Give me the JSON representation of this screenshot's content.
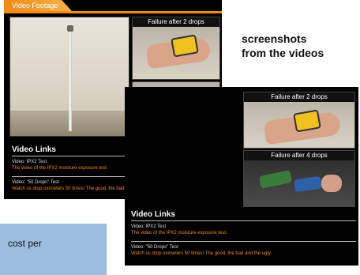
{
  "back_panel": {
    "tab_label": "Video Footage",
    "thumb1_title": "Failure after 2 drops",
    "links": {
      "heading": "Video Links",
      "items": [
        {
          "title": "Video: IPX2 Test",
          "desc": "The video of the IPX2 moisture exposure test."
        },
        {
          "title": "Video: \"50 Drops\" Test",
          "desc": "Watch us drop oximeters 50 times! The good, the bad and the ugly."
        }
      ]
    }
  },
  "caption": {
    "line1": "screenshots",
    "line2": "from the videos"
  },
  "front_panel": {
    "thumb1_title": "Failure after 2 drops",
    "thumb2_title": "Failure after 4 drops",
    "links": {
      "heading": "Video Links",
      "items": [
        {
          "title": "Video: IPX2 Test",
          "desc": "The video of the IPX2 moisture exposure test."
        },
        {
          "title": "Video: \"50 Drops\" Test",
          "desc": "Watch us drop oximeters 50 times! The good, the bad and the ugly."
        }
      ]
    }
  },
  "blue_card": {
    "text": "cost per"
  }
}
